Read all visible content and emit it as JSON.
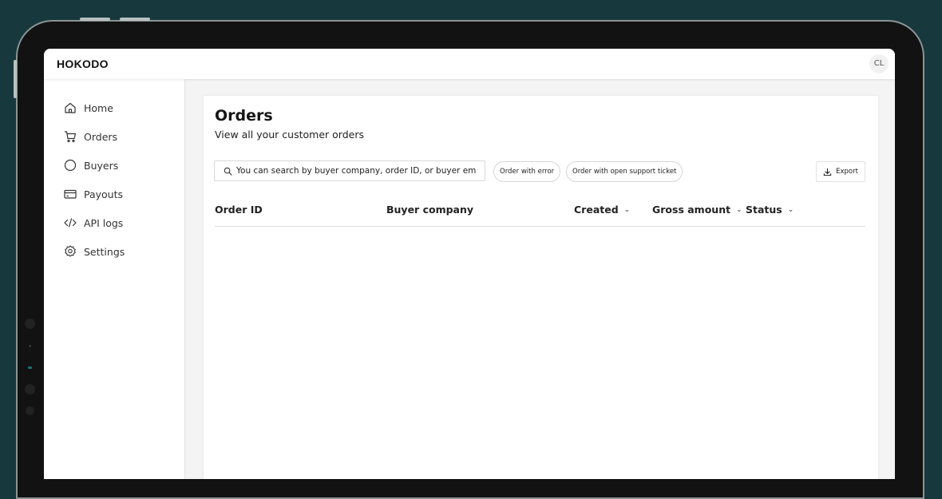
{
  "brand": {
    "logo_text": "HOKODO",
    "user_initials": "CL"
  },
  "sidebar": {
    "items": [
      {
        "label": "Home",
        "icon": "home-icon"
      },
      {
        "label": "Orders",
        "icon": "cart-icon"
      },
      {
        "label": "Buyers",
        "icon": "circle-icon"
      },
      {
        "label": "Payouts",
        "icon": "card-icon"
      },
      {
        "label": "API logs",
        "icon": "code-icon"
      },
      {
        "label": "Settings",
        "icon": "gear-icon"
      }
    ]
  },
  "page": {
    "title": "Orders",
    "subtitle": "View all your customer orders"
  },
  "search": {
    "placeholder": "You can search by buyer company, order ID, or buyer email",
    "value": ""
  },
  "filters": [
    {
      "label": "Order with error"
    },
    {
      "label": "Order with open support ticket"
    }
  ],
  "toolbar": {
    "export_label": "Export"
  },
  "table": {
    "columns": [
      {
        "label": "Order ID",
        "sortable": false
      },
      {
        "label": "Buyer company",
        "sortable": false
      },
      {
        "label": "Created",
        "sortable": true
      },
      {
        "label": "Gross amount",
        "sortable": true
      },
      {
        "label": "Status",
        "sortable": true
      }
    ],
    "rows": []
  },
  "colors": {
    "background": "#17393d",
    "screen": "#f4f4f4",
    "panel": "#ffffff",
    "text": "#1b1b1b"
  }
}
